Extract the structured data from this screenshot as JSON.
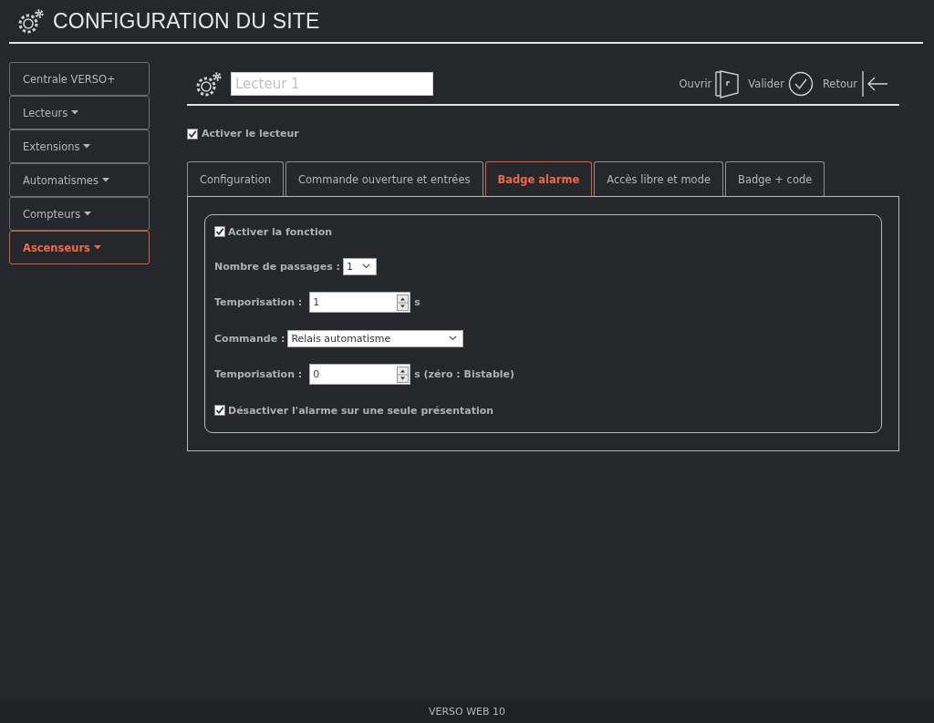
{
  "header": {
    "title": "CONFIGURATION DU SITE"
  },
  "sidebar": {
    "items": [
      {
        "label": "Centrale VERSO+",
        "dropdown": false,
        "selected": false
      },
      {
        "label": "Lecteurs",
        "dropdown": true,
        "selected": false
      },
      {
        "label": "Extensions",
        "dropdown": true,
        "selected": false
      },
      {
        "label": "Automatismes",
        "dropdown": true,
        "selected": false
      },
      {
        "label": "Compteurs",
        "dropdown": true,
        "selected": false
      },
      {
        "label": "Ascenseurs",
        "dropdown": true,
        "selected": true
      }
    ]
  },
  "toolbar": {
    "name_field": {
      "placeholder": "Lecteur 1"
    },
    "actions": [
      {
        "kind": "open",
        "label": "Ouvrir"
      },
      {
        "kind": "validate",
        "label": "Valider"
      },
      {
        "kind": "back",
        "label": "Retour"
      }
    ]
  },
  "enable_reader": {
    "label": "Activer le lecteur",
    "checked": true
  },
  "tabs": [
    {
      "label": "Configuration",
      "selected": false
    },
    {
      "label": "Commande ouverture et entrées",
      "selected": false
    },
    {
      "label": "Badge alarme",
      "selected": true
    },
    {
      "label": "Accès libre et mode",
      "selected": false
    },
    {
      "label": "Badge + code",
      "selected": false
    }
  ],
  "form": [
    {
      "kind": "checkbox",
      "label": "Activer la fonction",
      "checked": true
    },
    {
      "kind": "select",
      "label": "Nombre de passages :",
      "value": "1"
    },
    {
      "kind": "number",
      "label": "Temporisation :",
      "value": "1",
      "unit": "s"
    },
    {
      "kind": "select",
      "label": "Commande :",
      "value": "Relais automatisme"
    },
    {
      "kind": "number",
      "label": "Temporisation :",
      "value": "0",
      "unit": "s (zéro : Bistable)"
    },
    {
      "kind": "checkbox",
      "label": "Désactiver l'alarme sur une seule présentation",
      "checked": true
    }
  ],
  "footer": {
    "text": "VERSO WEB 10"
  }
}
